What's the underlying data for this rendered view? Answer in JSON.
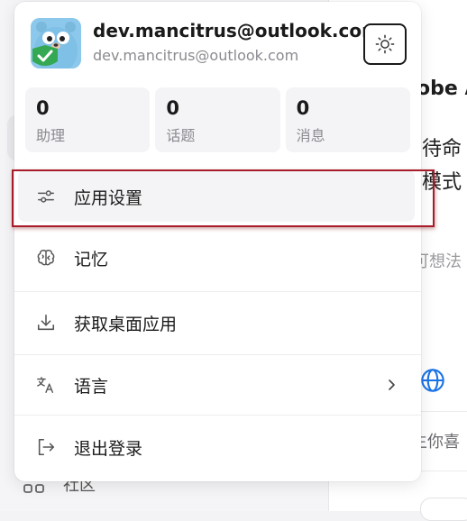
{
  "account": {
    "email": "dev.mancitrus@outlook.com",
    "email_secondary": "dev.mancitrus@outlook.com"
  },
  "stats": [
    {
      "value": "0",
      "label": "助理"
    },
    {
      "value": "0",
      "label": "话题"
    },
    {
      "value": "0",
      "label": "消息"
    }
  ],
  "menu": {
    "app_settings": "应用设置",
    "memory": "记忆",
    "get_desktop_app": "获取桌面应用",
    "language": "语言",
    "logout": "退出登录"
  },
  "icons": {
    "theme": "sun-icon",
    "app_settings": "sliders-icon",
    "memory": "brain-icon",
    "download": "download-icon",
    "language": "translate-icon",
    "logout": "logout-icon",
    "chevron": "chevron-right-icon"
  },
  "background": {
    "title_fragment": "obe A",
    "line1": "待命",
    "line2": "模式",
    "placeholder": "可想法",
    "like_text": "生你喜",
    "community": "社区"
  },
  "colors": {
    "annotation": "#a81c2a",
    "globe": "#1a73e8"
  }
}
